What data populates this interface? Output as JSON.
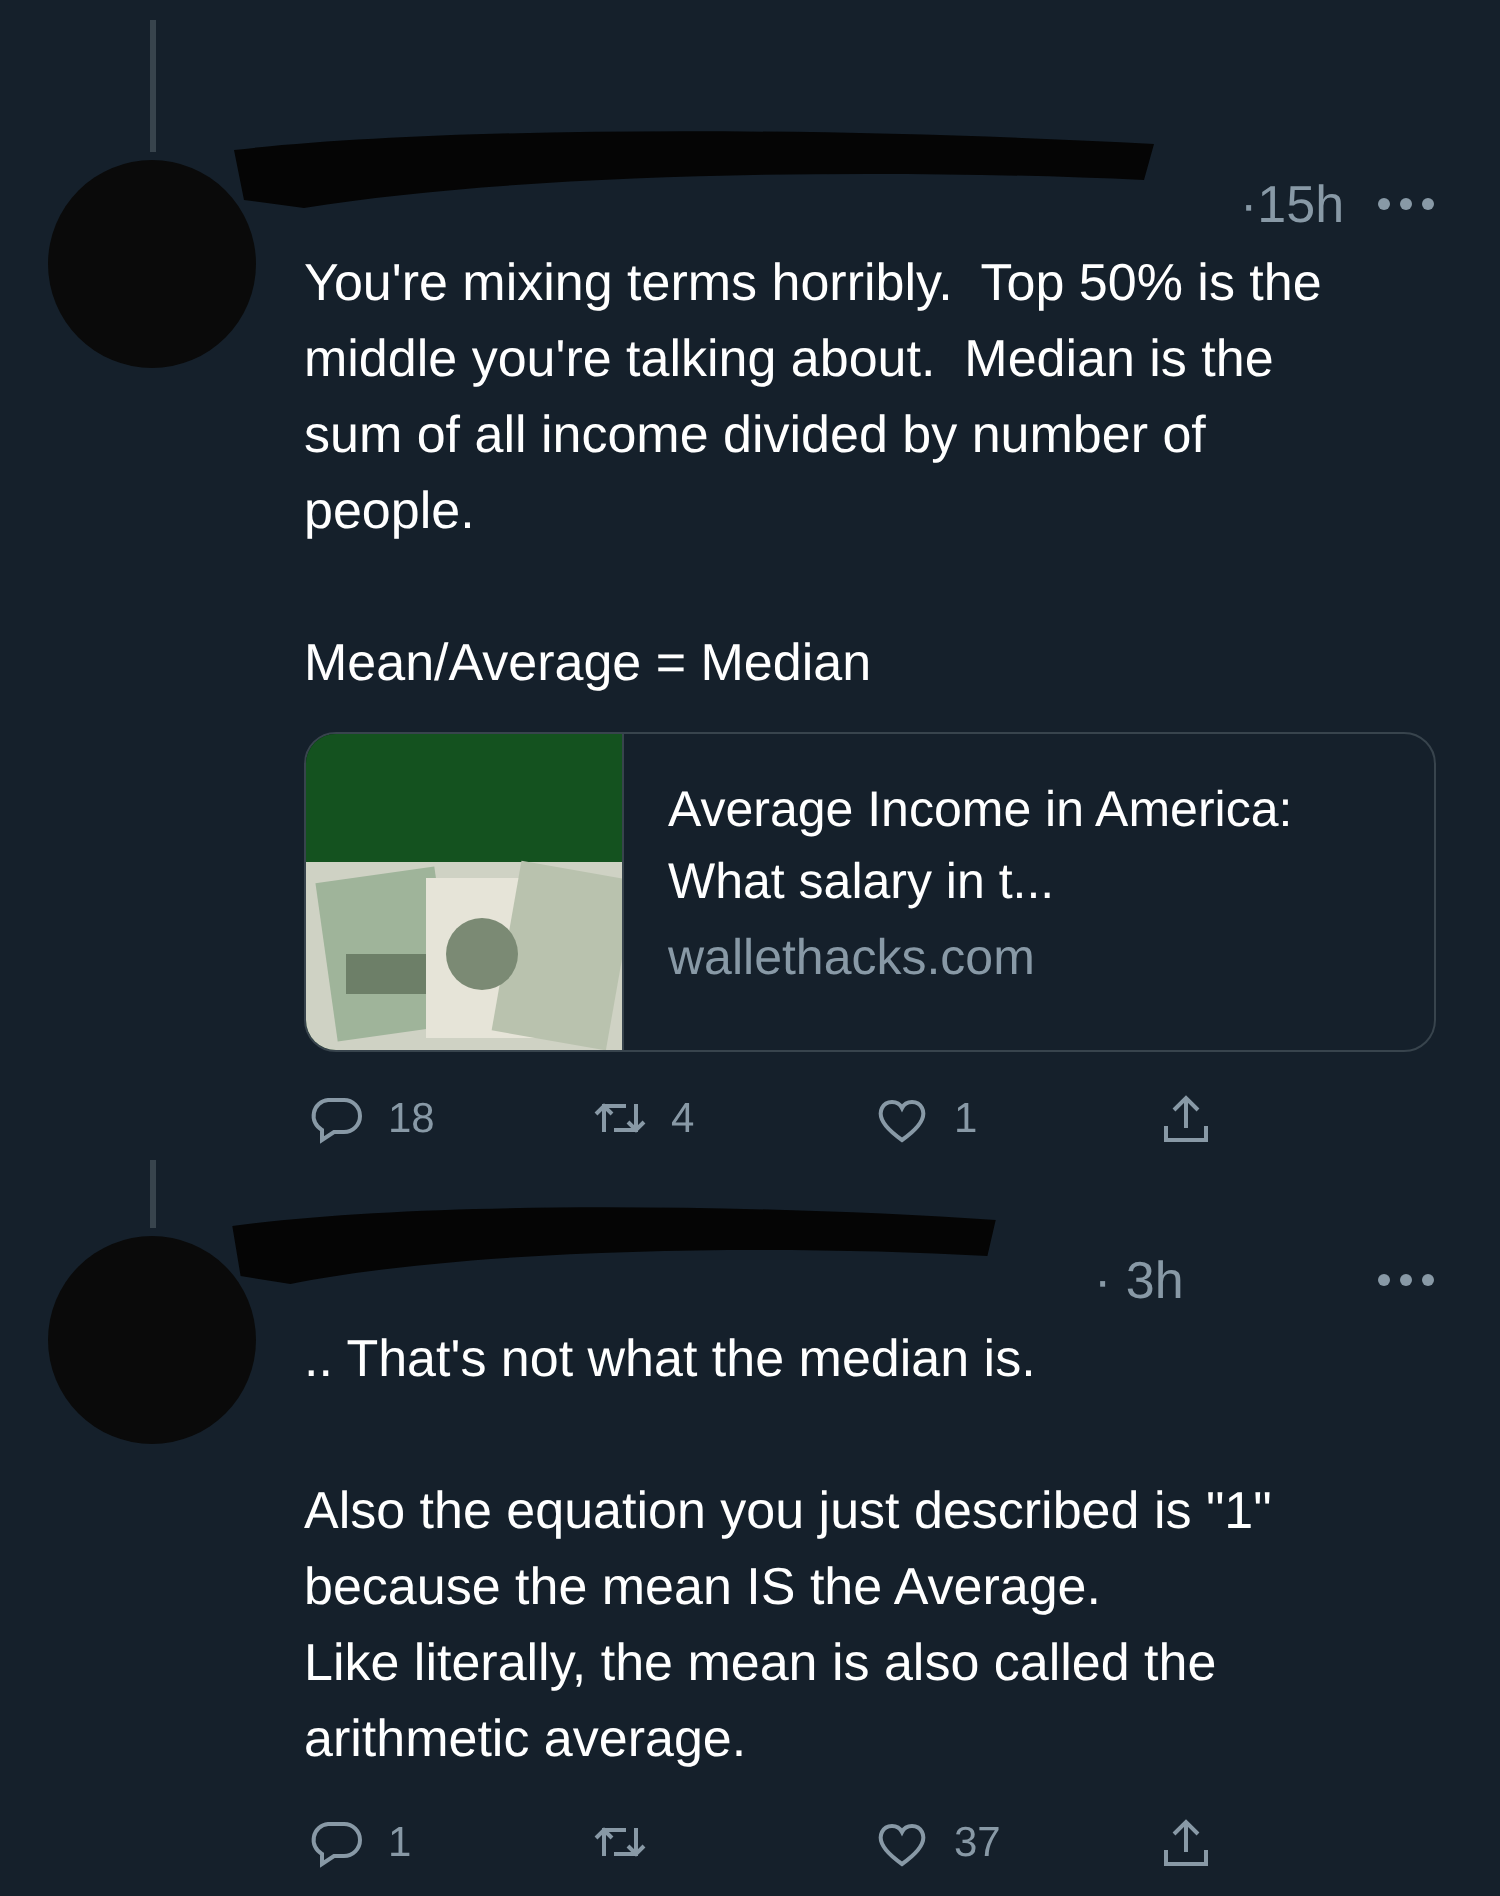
{
  "tweets": [
    {
      "time": "·15h",
      "paragraphs": [
        "You're mixing terms horribly.  Top 50% is the middle you're talking about.  Median is the sum of all income divided by number of people.",
        "Mean/Average = Median"
      ],
      "card": {
        "title": "Average Income in America: What salary in t...",
        "domain": "wallethacks.com"
      },
      "actions": [
        {
          "kind": "reply",
          "count": "18"
        },
        {
          "kind": "retweet",
          "count": "4"
        },
        {
          "kind": "like",
          "count": "1"
        },
        {
          "kind": "share"
        }
      ]
    },
    {
      "time": "· 3h",
      "paragraphs": [
        ".. That's not what the median is.",
        "Also the equation you just described is \"1\" because the mean IS the Average.\nLike literally, the mean is also called the arithmetic average."
      ],
      "actions": [
        {
          "kind": "reply",
          "count": "1"
        },
        {
          "kind": "retweet"
        },
        {
          "kind": "like",
          "count": "37"
        },
        {
          "kind": "share"
        }
      ]
    }
  ]
}
